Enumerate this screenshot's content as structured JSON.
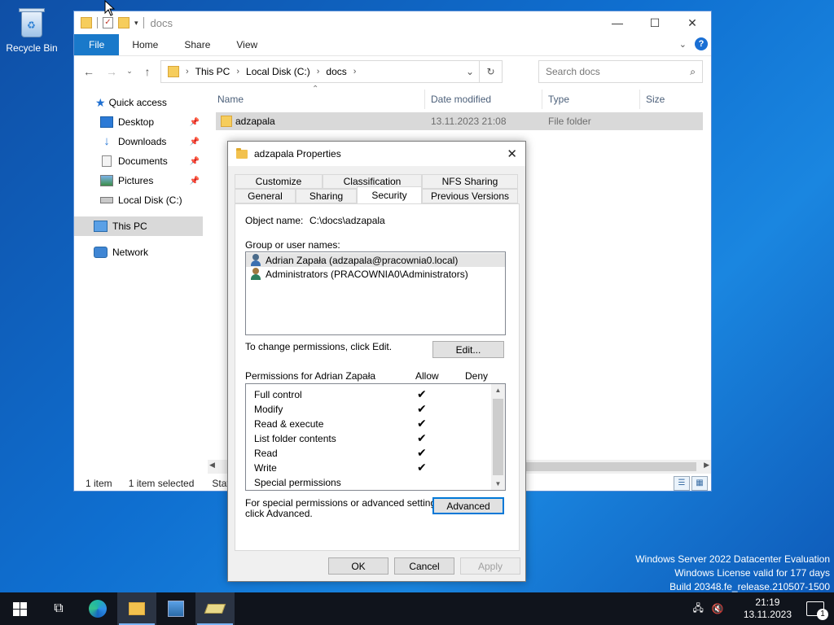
{
  "desktop": {
    "recycle_bin_label": "Recycle Bin",
    "watermark": [
      "Windows Server 2022 Datacenter Evaluation",
      "Windows License valid for 177 days",
      "Build 20348.fe_release.210507-1500"
    ]
  },
  "explorer": {
    "title": "docs",
    "ribbon_tabs": [
      "File",
      "Home",
      "Share",
      "View"
    ],
    "address": [
      "This PC",
      "Local Disk (C:)",
      "docs"
    ],
    "search_placeholder": "Search docs",
    "nav": {
      "quick_access": "Quick access",
      "items": [
        "Desktop",
        "Downloads",
        "Documents",
        "Pictures",
        "Local Disk (C:)"
      ],
      "this_pc": "This PC",
      "network": "Network"
    },
    "columns": [
      "Name",
      "Date modified",
      "Type",
      "Size"
    ],
    "rows": [
      {
        "name": "adzapala",
        "date": "13.11.2023 21:08",
        "type": "File folder"
      }
    ],
    "status": {
      "count": "1 item",
      "selected": "1 item selected",
      "state": "Stat"
    }
  },
  "dialog": {
    "title": "adzapala Properties",
    "tabs_row1": [
      "Customize",
      "Classification",
      "NFS Sharing"
    ],
    "tabs_row2": [
      "General",
      "Sharing",
      "Security",
      "Previous Versions"
    ],
    "active_tab": "Security",
    "object_name_label": "Object name:",
    "object_name_value": "C:\\docs\\adzapala",
    "group_label": "Group or user names:",
    "users": [
      "Adrian Zapała (adzapala@pracownia0.local)",
      "Administrators (PRACOWNIA0\\Administrators)"
    ],
    "change_text": "To change permissions, click Edit.",
    "edit_button": "Edit...",
    "permissions_for": "Permissions for Adrian Zapała",
    "allow_label": "Allow",
    "deny_label": "Deny",
    "permissions": [
      {
        "name": "Full control",
        "allow": true
      },
      {
        "name": "Modify",
        "allow": true
      },
      {
        "name": "Read & execute",
        "allow": true
      },
      {
        "name": "List folder contents",
        "allow": true
      },
      {
        "name": "Read",
        "allow": true
      },
      {
        "name": "Write",
        "allow": true
      },
      {
        "name": "Special permissions",
        "allow": false
      }
    ],
    "check_glyph": "✔",
    "special_text_1": "For special permissions or advanced settings,",
    "special_text_2": "click Advanced.",
    "advanced_button": "Advanced",
    "ok_button": "OK",
    "cancel_button": "Cancel",
    "apply_button": "Apply"
  },
  "taskbar": {
    "time": "21:19",
    "date": "13.11.2023",
    "notification_count": "1"
  }
}
